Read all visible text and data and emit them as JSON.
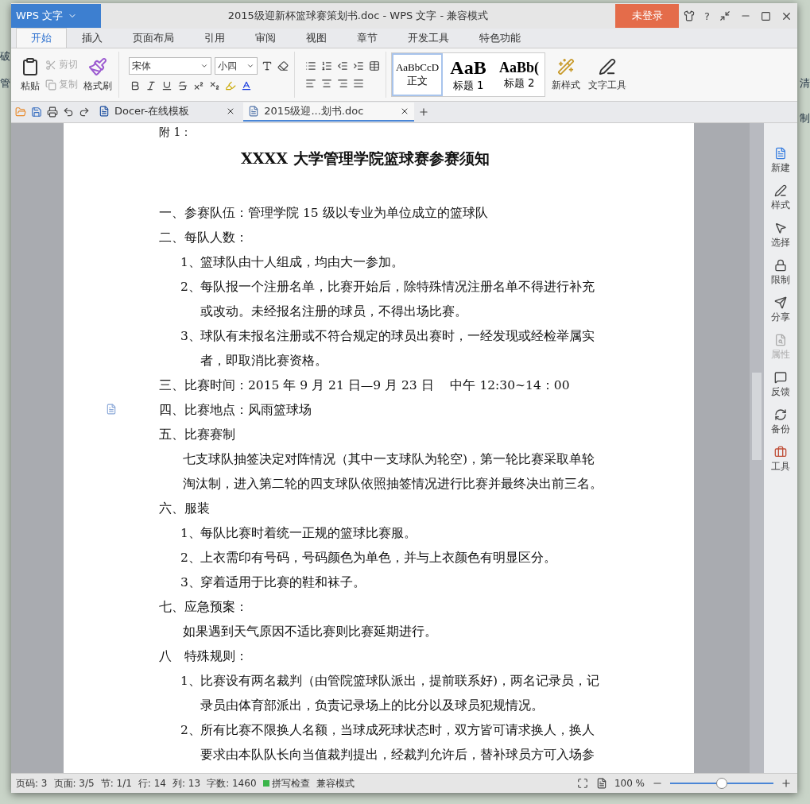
{
  "desktop": {
    "left_fragments": [
      "破",
      "管"
    ],
    "right_fragments": [
      "清",
      "制"
    ]
  },
  "window": {
    "app_button": "WPS 文字",
    "title": "2015级迎新杯篮球赛策划书.doc - WPS 文字 - 兼容模式",
    "login_button": "未登录",
    "help": "?"
  },
  "ribbon_tabs": [
    {
      "label": "开始",
      "selected": true
    },
    {
      "label": "插入",
      "selected": false
    },
    {
      "label": "页面布局",
      "selected": false
    },
    {
      "label": "引用",
      "selected": false
    },
    {
      "label": "审阅",
      "selected": false
    },
    {
      "label": "视图",
      "selected": false
    },
    {
      "label": "章节",
      "selected": false
    },
    {
      "label": "开发工具",
      "selected": false
    },
    {
      "label": "特色功能",
      "selected": false
    }
  ],
  "clipboard": {
    "paste": "粘贴",
    "cut": {
      "label": "剪切",
      "disabled": true
    },
    "copy": {
      "label": "复制",
      "disabled": true
    },
    "format_painter": "格式刷"
  },
  "font": {
    "name": "宋体",
    "size": "小四"
  },
  "styles": [
    {
      "sample": "AaBbCcD",
      "label": "正文",
      "kind": "normal",
      "selected": true
    },
    {
      "sample": "AaB",
      "label": "标题 1",
      "kind": "h1",
      "selected": false
    },
    {
      "sample": "AaBb(",
      "label": "标题 2",
      "kind": "h2",
      "selected": false
    }
  ],
  "new_style": "新样式",
  "text_tools": "文字工具",
  "doc_tabs": [
    {
      "label": "Docer-在线模板",
      "kind": "docer",
      "selected": false
    },
    {
      "label": "2015级迎...划书.doc",
      "kind": "doc",
      "selected": true
    }
  ],
  "document": {
    "preface": "附 1：",
    "title": "XXXX 大学管理学院篮球赛参赛须知",
    "paragraphs": [
      {
        "kind": "heading",
        "text": "一、参赛队伍：管理学院 15 级以专业为单位成立的篮球队"
      },
      {
        "kind": "heading",
        "text": "二、每队人数："
      },
      {
        "kind": "item",
        "number": "1、",
        "text": "篮球队由十人组成，均由大一参加。"
      },
      {
        "kind": "item",
        "number": "2、",
        "text": "每队报一个注册名单，比赛开始后，除特殊情况注册名单不得进行补充或改动。未经报名注册的球员，不得出场比赛。"
      },
      {
        "kind": "item",
        "number": "3、",
        "text": "球队有未报名注册或不符合规定的球员出赛时，一经发现或经检举属实者，即取消比赛资格。"
      },
      {
        "kind": "heading",
        "text": "三、比赛时间：2015 年 9 月 21 日—9 月 23 日　 中午 12:30~14：00"
      },
      {
        "kind": "heading",
        "text": "四、比赛地点：风雨篮球场",
        "marker": true
      },
      {
        "kind": "heading",
        "text": "五、比赛赛制"
      },
      {
        "kind": "body",
        "text": "七支球队抽签决定对阵情况（其中一支球队为轮空)，第一轮比赛采取单轮淘汰制，进入第二轮的四支球队依照抽签情况进行比赛并最终决出前三名。"
      },
      {
        "kind": "heading",
        "text": "六、服装"
      },
      {
        "kind": "item",
        "number": "1、",
        "text": "每队比赛时着统一正规的篮球比赛服。"
      },
      {
        "kind": "item",
        "number": "2、",
        "text": "上衣需印有号码，号码颜色为单色，并与上衣颜色有明显区分。"
      },
      {
        "kind": "item",
        "number": "3、",
        "text": "穿着适用于比赛的鞋和袜子。"
      },
      {
        "kind": "heading",
        "text": "七、应急预案："
      },
      {
        "kind": "body",
        "text": "如果遇到天气原因不适比赛则比赛延期进行。"
      },
      {
        "kind": "heading",
        "text": "八　特殊规则："
      },
      {
        "kind": "item",
        "number": "1、",
        "text": "比赛设有两名裁判（由管院篮球队派出，提前联系好)，两名记录员，记录员由体育部派出，负责记录场上的比分以及球员犯规情况。"
      },
      {
        "kind": "item",
        "number": "2、",
        "text": "所有比赛不限换人名额，当球成死球状态时，双方皆可请求换人，换人要求由本队队长向当值裁判提出，经裁判允许后，替补球员方可入场参"
      }
    ]
  },
  "side_panel": [
    {
      "label": "新建",
      "kind": "new",
      "disabled": false
    },
    {
      "label": "样式",
      "kind": "style",
      "disabled": false
    },
    {
      "label": "选择",
      "kind": "select",
      "disabled": false
    },
    {
      "label": "限制",
      "kind": "lock",
      "disabled": false
    },
    {
      "label": "分享",
      "kind": "share",
      "disabled": false
    },
    {
      "label": "属性",
      "kind": "props",
      "disabled": true
    },
    {
      "label": "反馈",
      "kind": "feedback",
      "disabled": false
    },
    {
      "label": "备份",
      "kind": "backup",
      "disabled": false
    },
    {
      "label": "工具",
      "kind": "tools",
      "disabled": false
    }
  ],
  "status_bar": {
    "items": [
      "页码: 3",
      "页面: 3/5",
      "节: 1/1",
      "行: 14",
      "列: 13",
      "字数: 1460"
    ],
    "spell_check": "拼写检查",
    "mode": "兼容模式",
    "zoom": "100 %",
    "zoom_slider": {
      "level": 0.5
    }
  }
}
